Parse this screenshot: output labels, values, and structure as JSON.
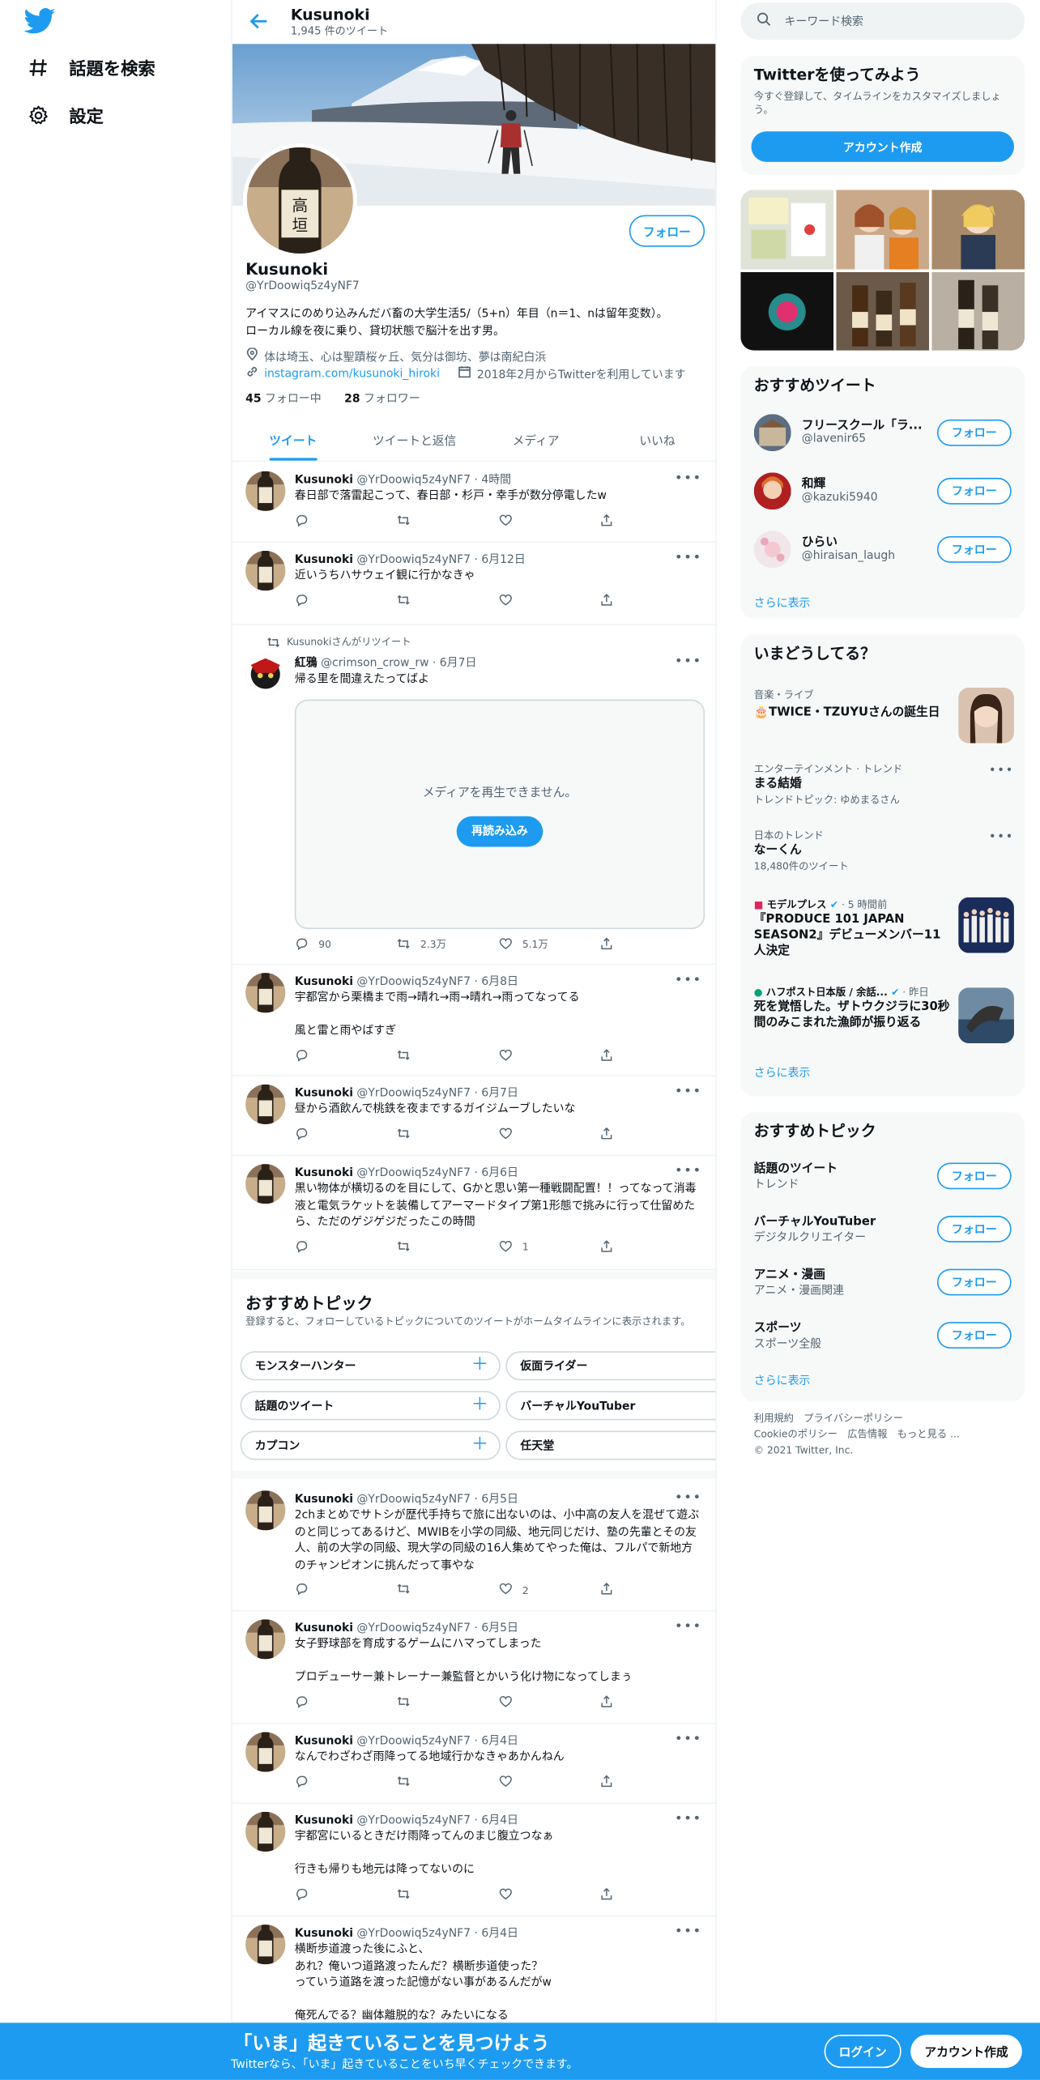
{
  "colors": {
    "accent": "#1d9bf0",
    "text": "#0f1419",
    "muted": "#536471",
    "border": "#eff3f4"
  },
  "nav": {
    "items": [
      {
        "icon": "hash-icon",
        "label": "話題を検索"
      },
      {
        "icon": "gear-icon",
        "label": "設定"
      }
    ]
  },
  "header": {
    "name": "Kusunoki",
    "tweet_count": "1,945 件のツイート"
  },
  "profile": {
    "follow": "フォロー",
    "name": "Kusunoki",
    "handle": "@YrDoowiq5z4yNF7",
    "bio": "アイマスにのめり込みんだバ畜の大学生活5/（5+n）年目（n＝1、nは留年変数）。\nローカル線を夜に乗り、貸切状態で脳汁を出す男。",
    "location": "体は埼玉、心は聖蹟桜ヶ丘、気分は御坊、夢は南紀白浜",
    "link": "instagram.com/kusunoki_hiroki",
    "joined": "2018年2月からTwitterを利用しています",
    "following_count": "45",
    "following_label": " フォロー中",
    "followers_count": "28",
    "followers_label": " フォロワー"
  },
  "tabs": [
    "ツイート",
    "ツイートと返信",
    "メディア",
    "いいね"
  ],
  "tweets": [
    {
      "name": "Kusunoki",
      "handle": "@YrDoowiq5z4yNF7",
      "time": "4時間",
      "text": "春日部で落雷起こって、春日部・杉戸・幸手が数分停電したw",
      "reply": "",
      "rt": "",
      "like": ""
    },
    {
      "name": "Kusunoki",
      "handle": "@YrDoowiq5z4yNF7",
      "time": "6月12日",
      "text": "近いうちハサウェイ観に行かなきゃ",
      "reply": "",
      "rt": "",
      "like": ""
    },
    {
      "rt_label": "Kusunokiさんがリツイート",
      "name": "紅鴉",
      "handle": "@crimson_crow_rw",
      "time": "6月7日",
      "text": "帰る里を間違えたってばよ",
      "media_msg": "メディアを再生できません。",
      "reload": "再読み込み",
      "reply": "90",
      "rt": "2.3万",
      "like": "5.1万"
    },
    {
      "name": "Kusunoki",
      "handle": "@YrDoowiq5z4yNF7",
      "time": "6月8日",
      "text": "宇都宮から栗橋まで雨→晴れ→雨→晴れ→雨ってなってる\n\n風と雷と雨やばすぎ",
      "reply": "",
      "rt": "",
      "like": ""
    },
    {
      "name": "Kusunoki",
      "handle": "@YrDoowiq5z4yNF7",
      "time": "6月7日",
      "text": "昼から酒飲んで桃鉄を夜までするガイジムーブしたいな",
      "reply": "",
      "rt": "",
      "like": ""
    },
    {
      "name": "Kusunoki",
      "handle": "@YrDoowiq5z4yNF7",
      "time": "6月6日",
      "text": "黒い物体が横切るのを目にして、Gかと思い第一種戦闘配置！！ってなって消毒液と電気ラケットを装備してアーマードタイプ第1形態で挑みに行って仕留めたら、ただのゲジゲジだったこの時間",
      "reply": "",
      "rt": "",
      "like": "1"
    },
    {
      "name": "Kusunoki",
      "handle": "@YrDoowiq5z4yNF7",
      "time": "6月5日",
      "text": "2chまとめでサトシが歴代手持ちで旅に出ないのは、小中高の友人を混ぜて遊ぶのと同じってあるけど、MWIBを小学の同級、地元同じだけ、塾の先輩とその友人、前の大学の同級、現大学の同級の16人集めてやった俺は、フルパで新地方のチャンピオンに挑んだって事やな",
      "reply": "",
      "rt": "",
      "like": "2"
    },
    {
      "name": "Kusunoki",
      "handle": "@YrDoowiq5z4yNF7",
      "time": "6月5日",
      "text": "女子野球部を育成するゲームにハマってしまった\n\nプロデューサー兼トレーナー兼監督とかいう化け物になってしまぅ",
      "reply": "",
      "rt": "",
      "like": ""
    },
    {
      "name": "Kusunoki",
      "handle": "@YrDoowiq5z4yNF7",
      "time": "6月4日",
      "text": "なんでわざわざ雨降ってる地域行かなきゃあかんねん",
      "reply": "",
      "rt": "",
      "like": ""
    },
    {
      "name": "Kusunoki",
      "handle": "@YrDoowiq5z4yNF7",
      "time": "6月4日",
      "text": "宇都宮にいるときだけ雨降ってんのまじ腹立つなぁ\n\n行きも帰りも地元は降ってないのに",
      "reply": "",
      "rt": "",
      "like": ""
    },
    {
      "name": "Kusunoki",
      "handle": "@YrDoowiq5z4yNF7",
      "time": "6月4日",
      "text": "横断歩道渡った後にふと、\nあれ？俺いつ道路渡ったんだ？横断歩道使った？\nっていう道路を渡った記憶がない事があるんだがw\n\n俺死んでる？幽体離脱的な？みたいになる"
    }
  ],
  "topics_inline": {
    "title": "おすすめトピック",
    "desc": "登録すると、フォローしているトピックについてのツイートがホームタイムラインに表示されます。",
    "chips": [
      "モンスターハンター",
      "仮面ライダー",
      "話題のツイート",
      "バーチャルYouTuber",
      "カプコン",
      "任天堂"
    ]
  },
  "right": {
    "search_placeholder": "キーワード検索",
    "signup": {
      "title": "Twitterを使ってみよう",
      "desc": "今すぐ登録して、タイムラインをカスタマイズしましょう。",
      "button": "アカウント作成"
    },
    "who": {
      "title": "おすすめツイート",
      "users": [
        {
          "name": "フリースクール「ラ...",
          "handle": "@lavenir65"
        },
        {
          "name": "和輝",
          "handle": "@kazuki5940"
        },
        {
          "name": "ひらい",
          "handle": "@hiraisan_laugh"
        }
      ],
      "follow": "フォロー",
      "more": "さらに表示"
    },
    "trends": {
      "title": "いまどうしてる？",
      "items": [
        {
          "cat": "音楽・ライブ",
          "title": "🎂TWICE・TZUYUさんの誕生日"
        },
        {
          "cat": "エンターテインメント · トレンド",
          "title": "まる結婚",
          "sub": "トレンドトピック: ゆめまるさん"
        },
        {
          "cat": "日本のトレンド",
          "title": "なーくん",
          "sub": "18,480件のツイート"
        },
        {
          "cat": "モデルプレス",
          "cat_time": " · 5 時間前",
          "title": "『PRODUCE 101 JAPAN SEASON2』デビューメンバー11人決定"
        },
        {
          "cat": "ハフポスト日本版 / 余話...",
          "cat_time": " · 昨日",
          "title": "死を覚悟した。ザトウクジラに30秒間のみこまれた漁師が振り返る"
        }
      ],
      "more": "さらに表示"
    },
    "topics": {
      "title": "おすすめトピック",
      "items": [
        {
          "name": "話題のツイート",
          "sub": "トレンド"
        },
        {
          "name": "バーチャルYouTuber",
          "sub": "デジタルクリエイター"
        },
        {
          "name": "アニメ・漫画",
          "sub": "アニメ・漫画関連"
        },
        {
          "name": "スポーツ",
          "sub": "スポーツ全般"
        }
      ],
      "follow": "フォロー",
      "more": "さらに表示"
    },
    "footer": {
      "l1": "利用規約　プライバシーポリシー",
      "l2": "Cookieのポリシー　広告情報　もっと見る ...",
      "l3": "© 2021 Twitter, Inc."
    }
  },
  "bottom": {
    "title": "「いま」起きていることを見つけよう",
    "sub": "Twitterなら、「いま」起きていることをいち早くチェックできます。",
    "login": "ログイン",
    "signup": "アカウント作成"
  }
}
